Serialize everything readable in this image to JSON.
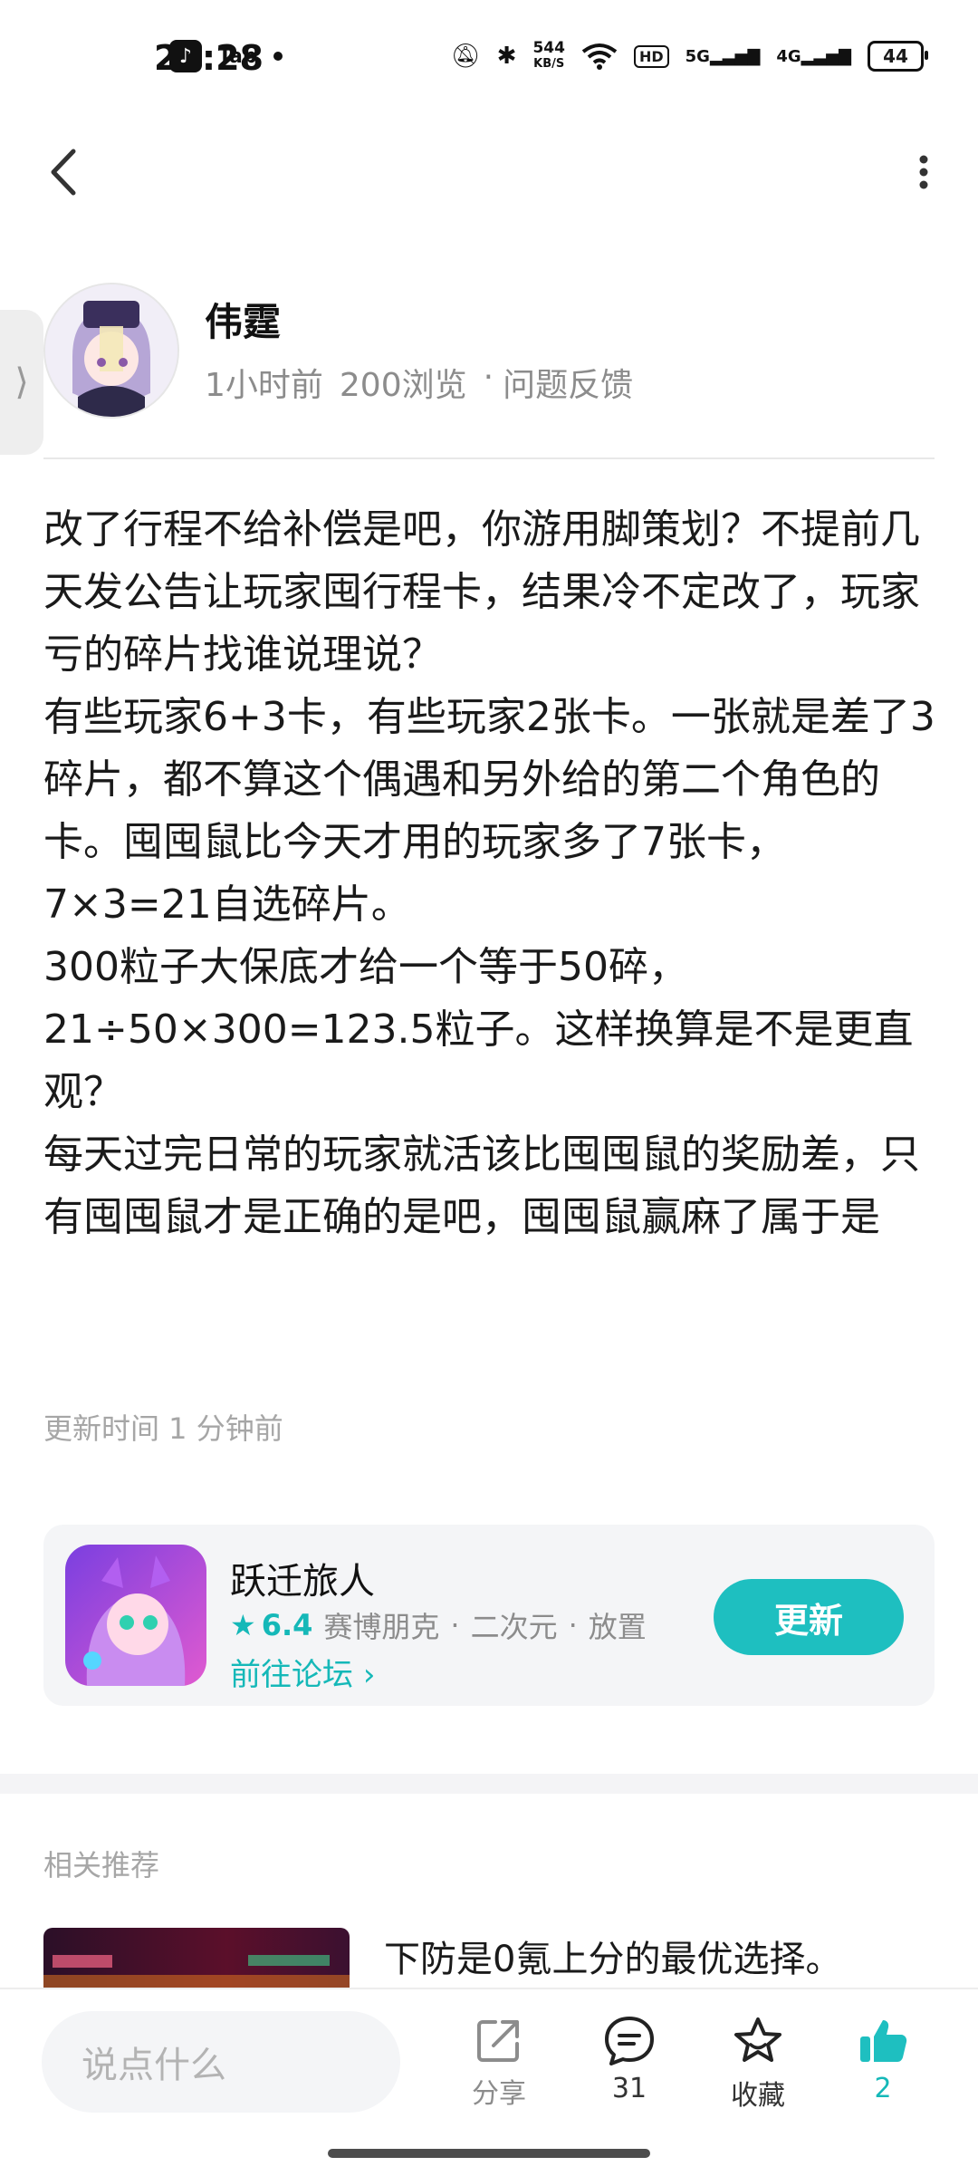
{
  "status_bar": {
    "time": "21:28",
    "app_label": "Tap",
    "net_speed_value": "544",
    "net_speed_unit": "KB/S",
    "hd_label": "HD",
    "sig1_label": "5G",
    "sig2_label": "4G",
    "battery": "44"
  },
  "post": {
    "author": "伟霆",
    "time_ago": "1小时前",
    "views": "200浏览",
    "category_sep": "·",
    "category": "问题反馈",
    "body": [
      "改了行程不给补偿是吧，你游用脚策划？不提前几天发公告让玩家囤行程卡，结果冷不定改了，玩家亏的碎片找谁说理说？",
      "有些玩家6+3卡，有些玩家2张卡。一张就是差了3碎片，都不算这个偶遇和另外给的第二个角色的卡。囤囤鼠比今天才用的玩家多了7张卡，7×3=21自选碎片。",
      "300粒子大保底才给一个等于50碎，21÷50×300=123.5粒子。这样换算是不是更直观？",
      "每天过完日常的玩家就活该比囤囤鼠的奖励差，只有囤囤鼠才是正确的是吧，囤囤鼠赢麻了属于是"
    ],
    "update_time": "更新时间 1 分钟前"
  },
  "game_card": {
    "title": "跃迁旅人",
    "rating": "6.4",
    "tags": [
      "赛博朋克",
      "·",
      "二次元",
      "·",
      "放置"
    ],
    "forum_link": "前往论坛",
    "update_button": "更新"
  },
  "related": {
    "title": "相关推荐",
    "first_item_text": "下防是0氪上分的最优选择。"
  },
  "bottom_bar": {
    "comment_placeholder": "说点什么",
    "share_label": "分享",
    "comment_count": "31",
    "favorite_label": "收藏",
    "like_count": "2"
  },
  "colors": {
    "accent": "#1ebfc0",
    "accent_text": "#15b8b8",
    "muted_text": "#8c8c8c"
  }
}
